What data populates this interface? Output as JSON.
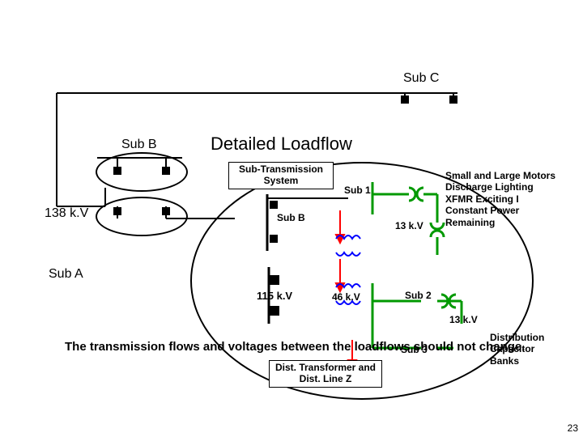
{
  "title": "Detailed Loadflow",
  "labels": {
    "subA": "Sub A",
    "subB": "Sub B",
    "subC": "Sub C",
    "subB2": "Sub B",
    "sub1": "Sub 1",
    "sub2": "Sub 2",
    "sub3": "Sub 3",
    "kv138": "138 k.V",
    "kv115": "115 k.V",
    "kv46": "46 k.V",
    "kv13a": "13 k.V",
    "kv13b": "13 k.V"
  },
  "boxes": {
    "subtrans": "Sub-Transmission\nSystem",
    "distz": "Dist. Transformer\nand Dist. Line Z"
  },
  "paragraph": "The transmission flows\nand voltages between\nthe loadflows should\nnot change.",
  "load_list": "Small and Large Motors\nDischarge Lighting\nXFMR Exciting I\nConstant Power\nRemaining",
  "cap_list": "Distribution\nCapacitor\nBanks",
  "page": "23",
  "colors": {
    "feeder": "#009900",
    "arrow": "#ff0000",
    "xfmr": "#0000ff"
  }
}
